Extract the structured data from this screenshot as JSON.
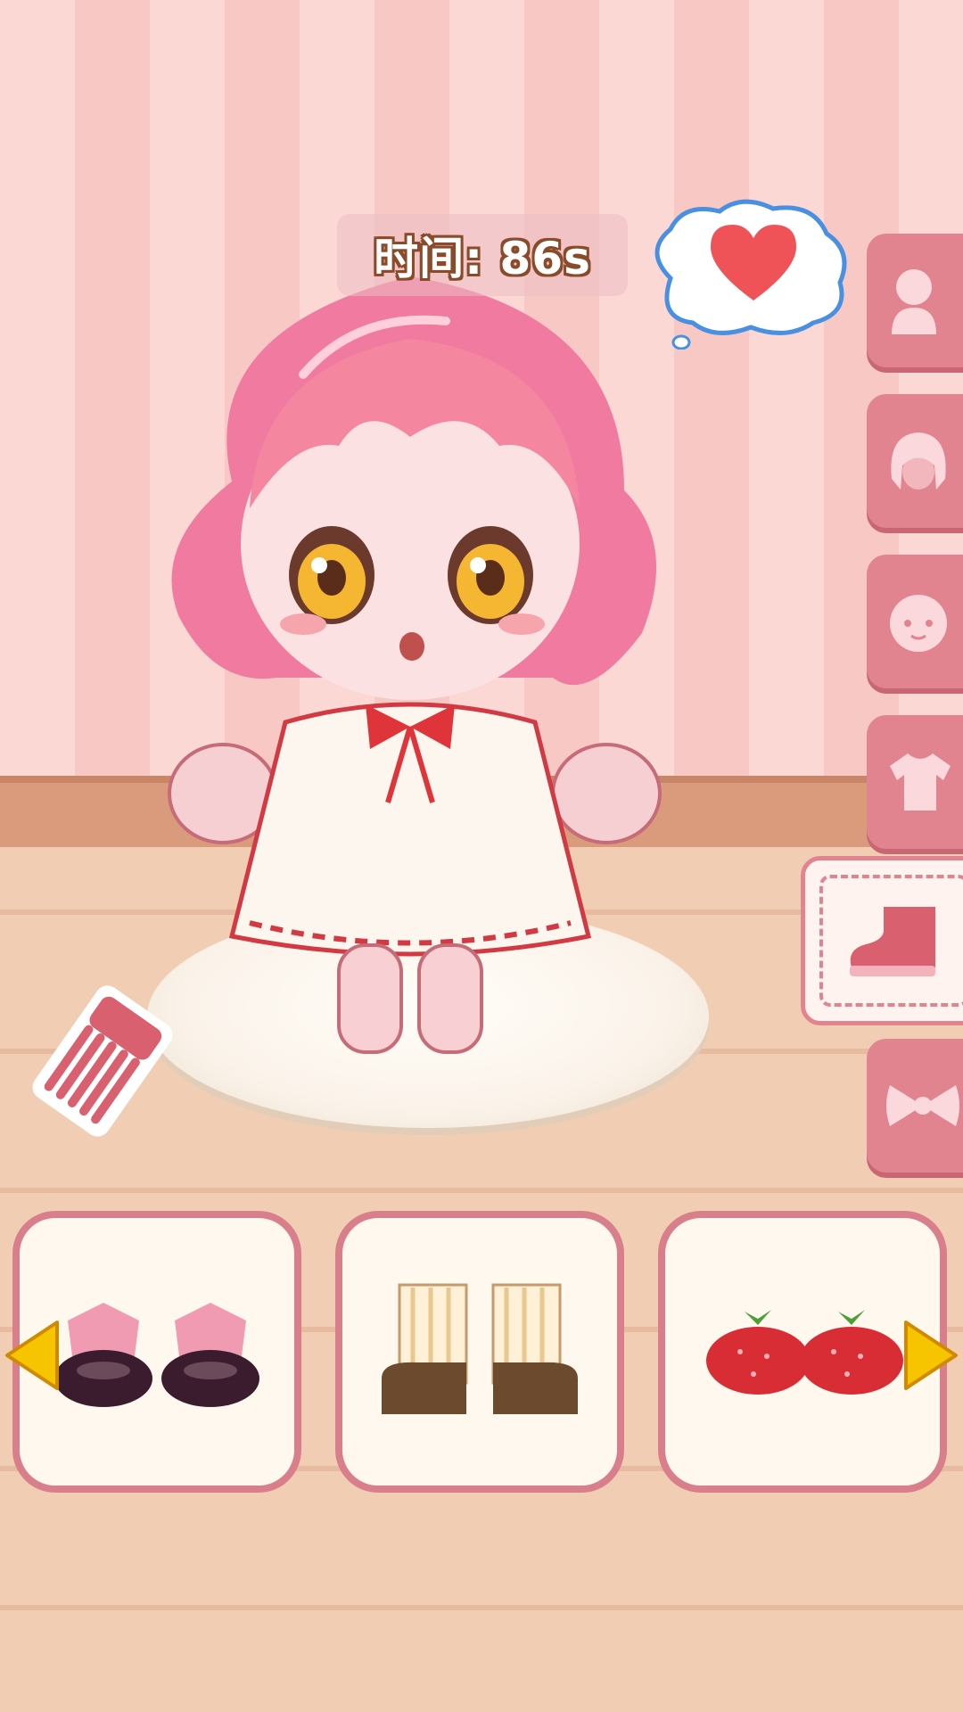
{
  "hud": {
    "timer_text": "时间: 86s"
  },
  "thought_bubble": {
    "icon": "heart-icon",
    "color": "#ef5358"
  },
  "categories": [
    {
      "icon": "body-icon",
      "selected": false
    },
    {
      "icon": "hair-icon",
      "selected": false
    },
    {
      "icon": "face-icon",
      "selected": false
    },
    {
      "icon": "shirt-icon",
      "selected": false
    },
    {
      "icon": "shoe-icon",
      "selected": true
    },
    {
      "icon": "bow-icon",
      "selected": false
    }
  ],
  "items": [
    {
      "icon": "pink-bow-slippers-icon"
    },
    {
      "icon": "striped-sock-sandals-icon"
    },
    {
      "icon": "strawberry-shoes-icon"
    }
  ],
  "colors": {
    "accent": "#e1848f",
    "arrow": "#f7c400"
  }
}
